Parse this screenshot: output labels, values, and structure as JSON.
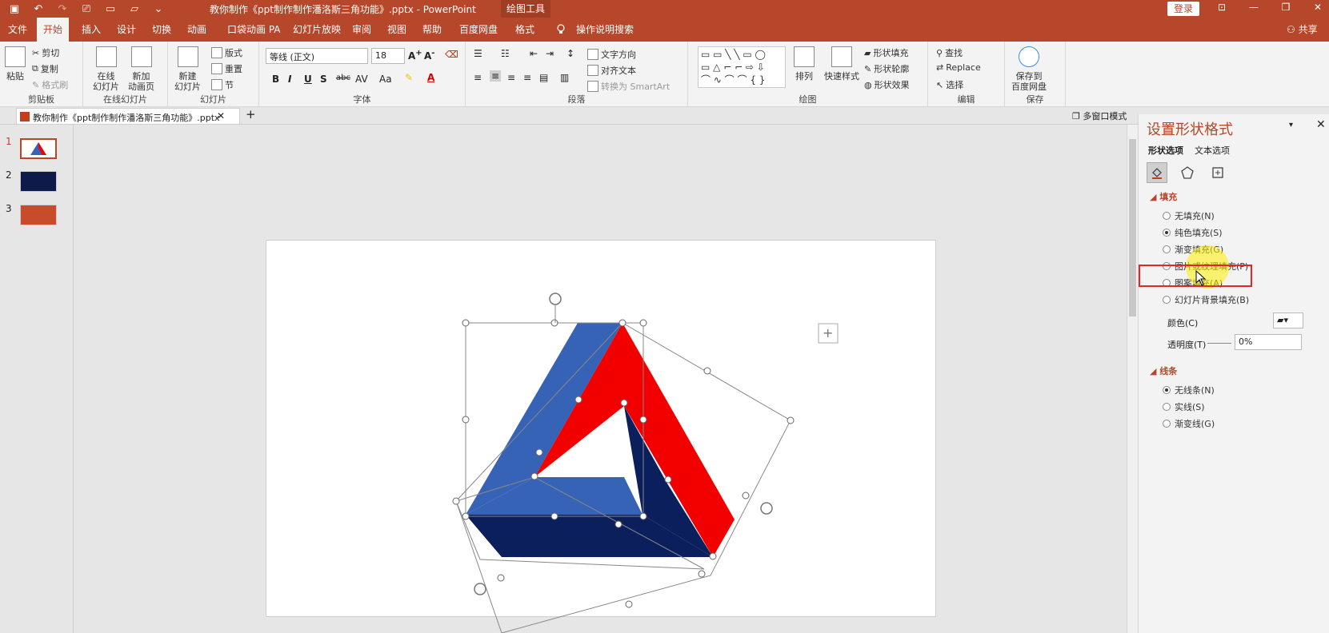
{
  "window": {
    "doc_title": "教你制作《ppt制作制作潘洛斯三角功能》.pptx  -  PowerPoint",
    "context_tab": "绘图工具",
    "login": "登录"
  },
  "tabs": [
    "文件",
    "开始",
    "插入",
    "设计",
    "切换",
    "动画",
    "口袋动画 PA",
    "幻灯片放映",
    "审阅",
    "视图",
    "帮助",
    "百度网盘",
    "格式"
  ],
  "tell_me": "操作说明搜索",
  "share": "共享",
  "ribbon": {
    "clipboard": {
      "label": "剪贴板",
      "paste": "粘贴",
      "cut": "剪切",
      "copy": "复制",
      "painter": "格式刷"
    },
    "online_slides": {
      "label": "在线幻灯片",
      "online": "在线\n幻灯片",
      "new_anim": "新加\n动画页"
    },
    "slides": {
      "label": "幻灯片",
      "new_slide": "新建\n幻灯片",
      "layout": "版式",
      "reset": "重置",
      "section": "节"
    },
    "font": {
      "label": "字体",
      "name": "等线 (正文)",
      "size": "18"
    },
    "paragraph": {
      "label": "段落",
      "text_dir": "文字方向",
      "align_text": "对齐文本",
      "smartart": "转换为 SmartArt"
    },
    "drawing": {
      "label": "绘图",
      "arrange": "排列",
      "quick_styles": "快速样式",
      "fill": "形状填充",
      "outline": "形状轮廓",
      "effects": "形状效果"
    },
    "editing": {
      "label": "编辑",
      "find": "查找",
      "replace": "Replace",
      "select": "选择"
    },
    "save": {
      "label": "保存",
      "save_baidu": "保存到\n百度网盘"
    }
  },
  "doc_tab": {
    "name": "教你制作《ppt制作制作潘洛斯三角功能》.pptx",
    "multi_window": "多窗口模式"
  },
  "slides": [
    {
      "num": "1",
      "selected": true
    },
    {
      "num": "2",
      "selected": false
    },
    {
      "num": "3",
      "selected": false
    }
  ],
  "pane": {
    "title": "设置形状格式",
    "tab_shape": "形状选项",
    "tab_text": "文本选项",
    "fill_section": "填充",
    "fill_options": [
      {
        "label": "无填充(N)",
        "checked": false
      },
      {
        "label": "纯色填充(S)",
        "checked": true
      },
      {
        "label": "渐变填充(G)",
        "checked": false
      },
      {
        "label": "图片或纹理填充(P)",
        "checked": false
      },
      {
        "label": "图案填充(A)",
        "checked": false
      },
      {
        "label": "幻灯片背景填充(B)",
        "checked": false
      }
    ],
    "color_label": "颜色(C)",
    "transparency_label": "透明度(T)",
    "transparency_value": "0%",
    "line_section": "线条",
    "line_options": [
      {
        "label": "无线条(N)",
        "checked": true
      },
      {
        "label": "实线(S)",
        "checked": false
      },
      {
        "label": "渐变线(G)",
        "checked": false
      }
    ]
  },
  "colors": {
    "accent": "#b7472a",
    "triangle_blue": "#3763b6",
    "triangle_red": "#f20000",
    "triangle_navy": "#0b1f5c",
    "highlight_red": "#e0282b"
  }
}
